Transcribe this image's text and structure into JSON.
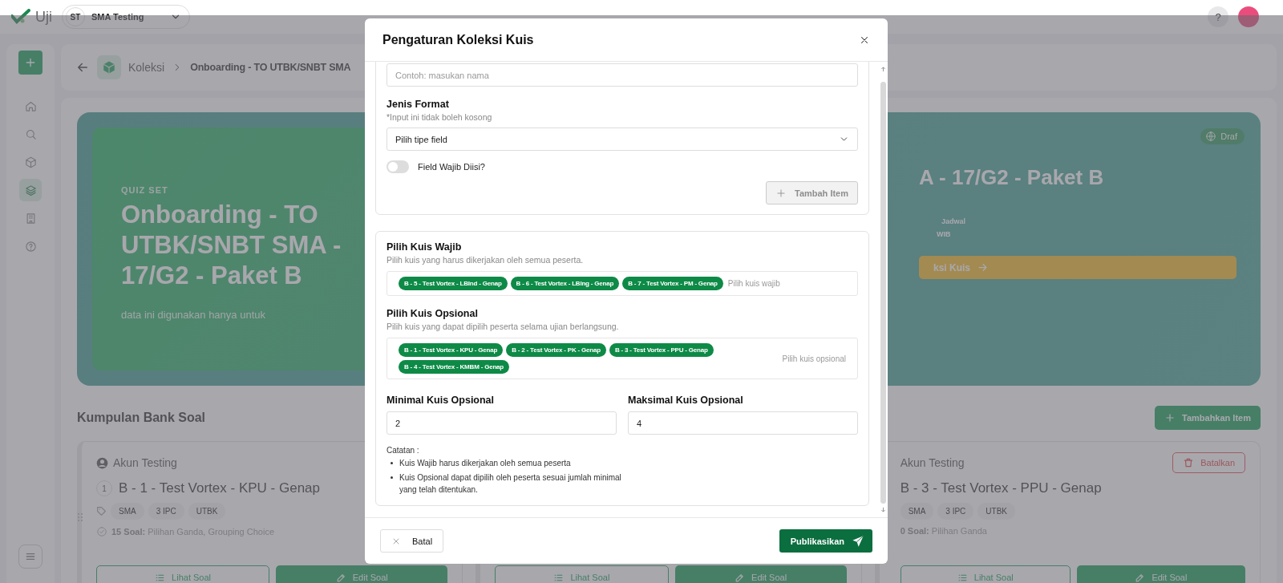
{
  "header": {
    "logo": "Uji",
    "workspace": {
      "initials": "ST",
      "name": "SMA Testing"
    },
    "help": "?"
  },
  "sidebar": {
    "items": [
      {
        "kind": "home",
        "selected": false
      },
      {
        "kind": "search",
        "selected": false
      },
      {
        "kind": "cube",
        "selected": false
      },
      {
        "kind": "layers",
        "selected": true
      },
      {
        "kind": "building",
        "selected": false
      },
      {
        "kind": "help",
        "selected": false
      }
    ]
  },
  "breadcrumb": {
    "section": "Koleksi",
    "current": "Onboarding - TO UTBK/SNBT SMA"
  },
  "banner": {
    "eyebrow": "QUIZ SET",
    "title": "Onboarding - TO UTBK/SNBT SMA - 17/G2 - Paket B",
    "note": "data ini digunakan hanya untuk",
    "status": "Draf",
    "title_right": "A - 17/G2 - Paket B",
    "schedule_label": "Jadwal",
    "schedule_time": "WIB",
    "action": "ksi Kuis"
  },
  "bank": {
    "title": "Kumpulan Bank Soal",
    "add_button": "Tambahkan Item",
    "cards": [
      {
        "author": "Akun Testing",
        "number": "1",
        "title": "B - 1 - Test Vortex - KPU - Genap",
        "tags": [
          "SMA",
          "3 IPC",
          "UTBK"
        ],
        "count": "15 Soal:",
        "types": "Pilihan Ganda, Grouping Choice",
        "buttons": [
          "Lihat Soal",
          "Edit Soal"
        ]
      },
      {
        "buttons": [
          "Lihat Soal",
          "Edit Soal"
        ]
      },
      {
        "author": "Akun Testing",
        "cancel": "Batalkan",
        "title": "B - 3 - Test Vortex - PPU - Genap",
        "tags": [
          "SMA",
          "3 IPC",
          "UTBK"
        ],
        "count": "0 Soal:",
        "types": "Pilihan Ganda",
        "buttons": [
          "Lihat Soal",
          "Edit Soal"
        ]
      }
    ]
  },
  "modal": {
    "title": "Pengaturan Koleksi Kuis",
    "name_field": {
      "placeholder": "Contoh: masukan nama"
    },
    "format": {
      "label": "Jenis Format",
      "hint": "*Input ini tidak boleh kosong",
      "select": "Pilih tipe field"
    },
    "required_toggle": {
      "label": "Field Wajib Diisi?",
      "on": false
    },
    "add_item": {
      "label": "Tambah Item",
      "disabled": true
    },
    "mandatory": {
      "label": "Pilih Kuis Wajib",
      "description": "Pilih kuis yang harus dikerjakan oleh semua peserta.",
      "chips": [
        "B - 5 - Test Vortex - LBInd - Genap",
        "B - 6 - Test Vortex - LBIng - Genap",
        "B - 7 - Test Vortex - PM - Genap"
      ],
      "placeholder": "Pilih kuis wajib"
    },
    "optional": {
      "label": "Pilih Kuis Opsional",
      "description": "Pilih kuis yang dapat dipilih peserta selama ujian berlangsung.",
      "chips": [
        "B - 1 - Test Vortex - KPU - Genap",
        "B - 2 - Test Vortex - PK - Genap",
        "B - 3 - Test Vortex - PPU - Genap",
        "B - 4 - Test Vortex - KMBM - Genap"
      ],
      "placeholder": "Pilih kuis opsional"
    },
    "min": {
      "label": "Minimal Kuis Opsional",
      "value": "2"
    },
    "max": {
      "label": "Maksimal Kuis Opsional",
      "value": "4"
    },
    "notes": {
      "title": "Catatan :",
      "items": [
        "Kuis Wajib harus dikerjakan oleh semua peserta",
        "Kuis Opsional dapat dipilih oleh peserta sesuai jumlah minimal yang telah ditentukan."
      ]
    },
    "cancel": "Batal",
    "publish": "Publikasikan"
  }
}
